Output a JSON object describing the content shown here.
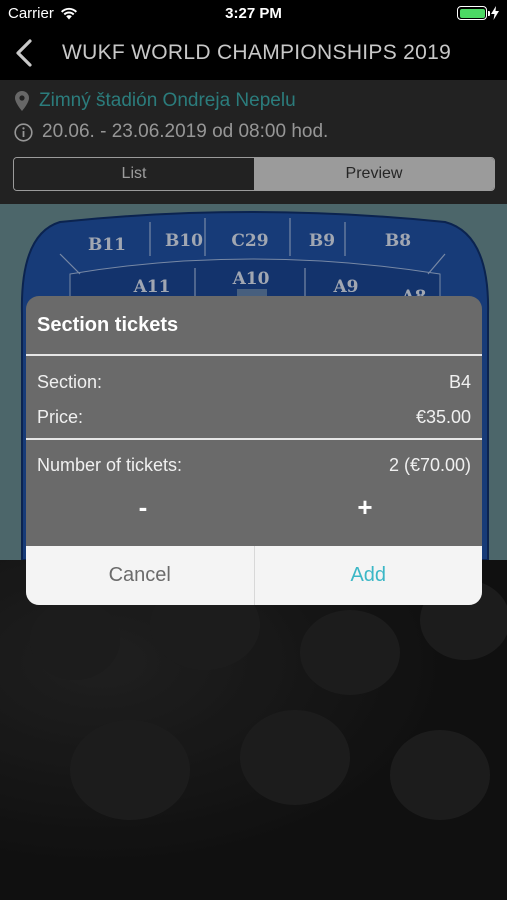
{
  "status_bar": {
    "carrier": "Carrier",
    "time": "3:27 PM"
  },
  "nav": {
    "title": "WUKF WORLD CHAMPIONSHIPS 2019",
    "back_icon": "chevron-left-icon"
  },
  "event": {
    "venue": "Zimný štadión Ondreja Nepelu",
    "dates": "20.06. - 23.06.2019 od 08:00 hod."
  },
  "segments": {
    "list": "List",
    "preview": "Preview",
    "selected": "Preview"
  },
  "arena": {
    "sections_outer": [
      "B11",
      "B10",
      "C29",
      "B9",
      "B8"
    ],
    "sections_inner": [
      "A11",
      "A10",
      "A9",
      "A8"
    ]
  },
  "dialog": {
    "title": "Section tickets",
    "section_label": "Section:",
    "section_value": "B4",
    "price_label": "Price:",
    "price_value": "€35.00",
    "count_label": "Number of tickets:",
    "count_value": "2 (€70.00)",
    "minus": "-",
    "plus": "+",
    "cancel": "Cancel",
    "add": "Add"
  },
  "colors": {
    "venue_link": "#3aa6a6",
    "add_button": "#3bb7c6",
    "arena_blue": "#1f4fa0",
    "preview_background": "#66888e"
  }
}
